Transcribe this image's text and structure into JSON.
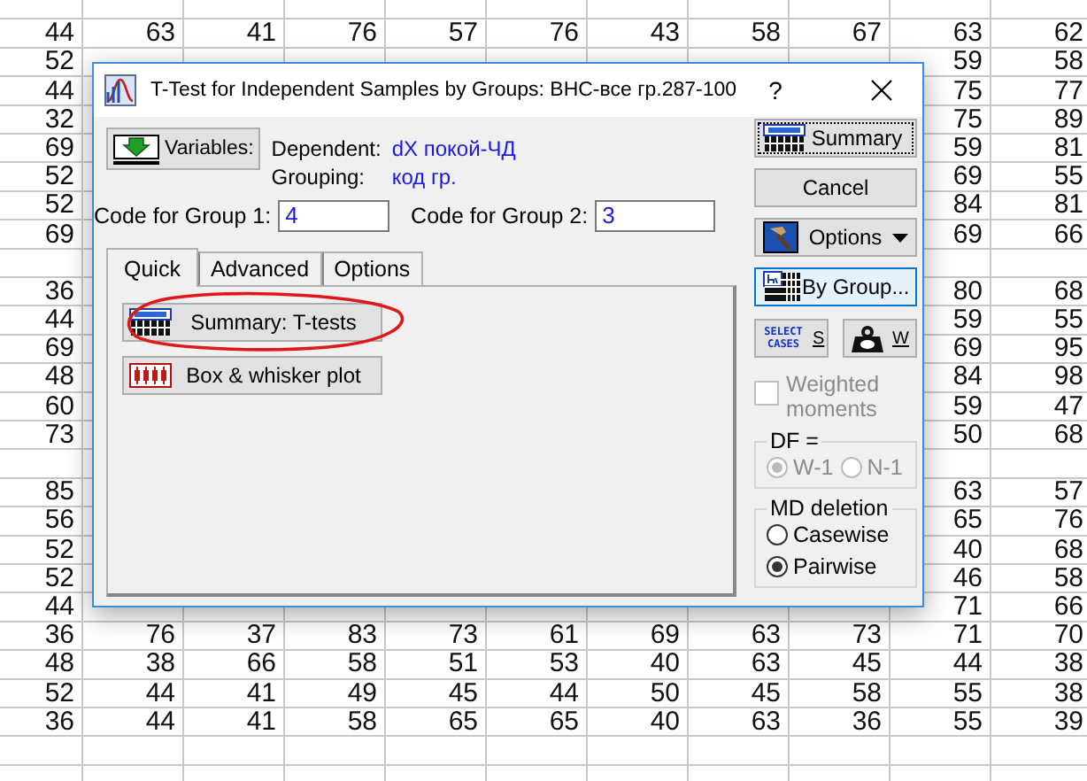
{
  "spreadsheet": {
    "rows": [
      [
        null,
        null,
        null,
        null,
        null,
        null,
        null,
        null,
        null,
        null,
        null
      ],
      [
        "44",
        "63",
        "41",
        "76",
        "57",
        "76",
        "43",
        "58",
        "67",
        "63",
        "62"
      ],
      [
        "52",
        null,
        null,
        null,
        null,
        null,
        null,
        null,
        null,
        "59",
        "58"
      ],
      [
        "44",
        null,
        null,
        null,
        null,
        null,
        null,
        null,
        null,
        "75",
        "77"
      ],
      [
        "32",
        null,
        null,
        null,
        null,
        null,
        null,
        null,
        null,
        "75",
        "89"
      ],
      [
        "69",
        null,
        null,
        null,
        null,
        null,
        null,
        null,
        null,
        "59",
        "81"
      ],
      [
        "52",
        null,
        null,
        null,
        null,
        null,
        null,
        null,
        null,
        "69",
        "55"
      ],
      [
        "52",
        null,
        null,
        null,
        null,
        null,
        null,
        null,
        null,
        "84",
        "81"
      ],
      [
        "69",
        null,
        null,
        null,
        null,
        null,
        null,
        null,
        null,
        "69",
        "66"
      ],
      [
        null,
        null,
        null,
        null,
        null,
        null,
        null,
        null,
        null,
        null,
        null
      ],
      [
        "36",
        null,
        null,
        null,
        null,
        null,
        null,
        null,
        null,
        "80",
        "68"
      ],
      [
        "44",
        null,
        null,
        null,
        null,
        null,
        null,
        null,
        null,
        "59",
        "55"
      ],
      [
        "69",
        null,
        null,
        null,
        null,
        null,
        null,
        null,
        null,
        "69",
        "95"
      ],
      [
        "48",
        null,
        null,
        null,
        null,
        null,
        null,
        null,
        null,
        "84",
        "98"
      ],
      [
        "60",
        null,
        null,
        null,
        null,
        null,
        null,
        null,
        null,
        "59",
        "47"
      ],
      [
        "73",
        null,
        null,
        null,
        null,
        null,
        null,
        null,
        null,
        "50",
        "68"
      ],
      [
        null,
        null,
        null,
        null,
        null,
        null,
        null,
        null,
        null,
        null,
        null
      ],
      [
        "85",
        null,
        null,
        null,
        null,
        null,
        null,
        null,
        null,
        "63",
        "57"
      ],
      [
        "56",
        null,
        null,
        null,
        null,
        null,
        null,
        null,
        null,
        "65",
        "76"
      ],
      [
        "52",
        null,
        null,
        null,
        null,
        null,
        null,
        null,
        null,
        "40",
        "68"
      ],
      [
        "52",
        null,
        null,
        null,
        null,
        null,
        null,
        null,
        null,
        "46",
        "58"
      ],
      [
        "44",
        null,
        null,
        null,
        null,
        null,
        null,
        null,
        null,
        "71",
        "66"
      ],
      [
        "36",
        "76",
        "37",
        "83",
        "73",
        "61",
        "69",
        "63",
        "73",
        "71",
        "70"
      ],
      [
        "48",
        "38",
        "66",
        "58",
        "51",
        "53",
        "40",
        "63",
        "45",
        "44",
        "38"
      ],
      [
        "52",
        "44",
        "41",
        "49",
        "45",
        "44",
        "50",
        "45",
        "58",
        "55",
        "38"
      ],
      [
        "36",
        "44",
        "41",
        "58",
        "65",
        "65",
        "40",
        "63",
        "36",
        "55",
        "39"
      ],
      [
        null,
        null,
        null,
        null,
        null,
        null,
        null,
        null,
        null,
        null,
        null
      ],
      [
        null,
        null,
        null,
        null,
        null,
        null,
        null,
        null,
        null,
        null,
        null
      ]
    ]
  },
  "dialog": {
    "title": "T-Test for Independent Samples by Groups: ВНС-все гр.287-100",
    "help_button": "?",
    "variables_button": "Variables:",
    "dependent": {
      "label": "Dependent:",
      "value": "dX  покой-ЧД"
    },
    "grouping": {
      "label": "Grouping:",
      "value": "код гр."
    },
    "group_codes": [
      {
        "label": "Code for Group 1:",
        "value": "4"
      },
      {
        "label": "Code for Group 2:",
        "value": "3"
      }
    ],
    "tabs": [
      {
        "label": "Quick",
        "selected": true
      },
      {
        "label": "Advanced",
        "selected": false
      },
      {
        "label": "Options",
        "selected": false
      }
    ],
    "quick_buttons": [
      {
        "label": "Summary: T-tests",
        "kind": "summary"
      },
      {
        "label": "Box & whisker plot",
        "kind": "boxplot"
      }
    ],
    "side_buttons": [
      {
        "label": "Summary",
        "kind": "summary",
        "focused": true,
        "highlighted": false
      },
      {
        "label": "Cancel",
        "kind": "plain",
        "focused": false,
        "highlighted": false
      },
      {
        "label": "Options",
        "kind": "menu",
        "focused": false,
        "highlighted": false
      },
      {
        "label": "By Group...",
        "kind": "bygroup",
        "focused": false,
        "highlighted": true
      }
    ],
    "small_buttons": [
      {
        "label": "S",
        "kind": "select_cases",
        "icon_text": "SELECT CASES"
      },
      {
        "label": "W",
        "kind": "weight"
      }
    ],
    "weighted_moments": {
      "label": "Weighted moments",
      "checked": false,
      "disabled": true
    },
    "df": {
      "title": "DF =",
      "disabled": true,
      "options": [
        {
          "label": "W-1",
          "selected": true
        },
        {
          "label": "N-1",
          "selected": false
        }
      ]
    },
    "md_deletion": {
      "title": "MD deletion",
      "disabled": false,
      "options": [
        {
          "label": "Casewise",
          "selected": false
        },
        {
          "label": "Pairwise",
          "selected": true
        }
      ]
    }
  }
}
